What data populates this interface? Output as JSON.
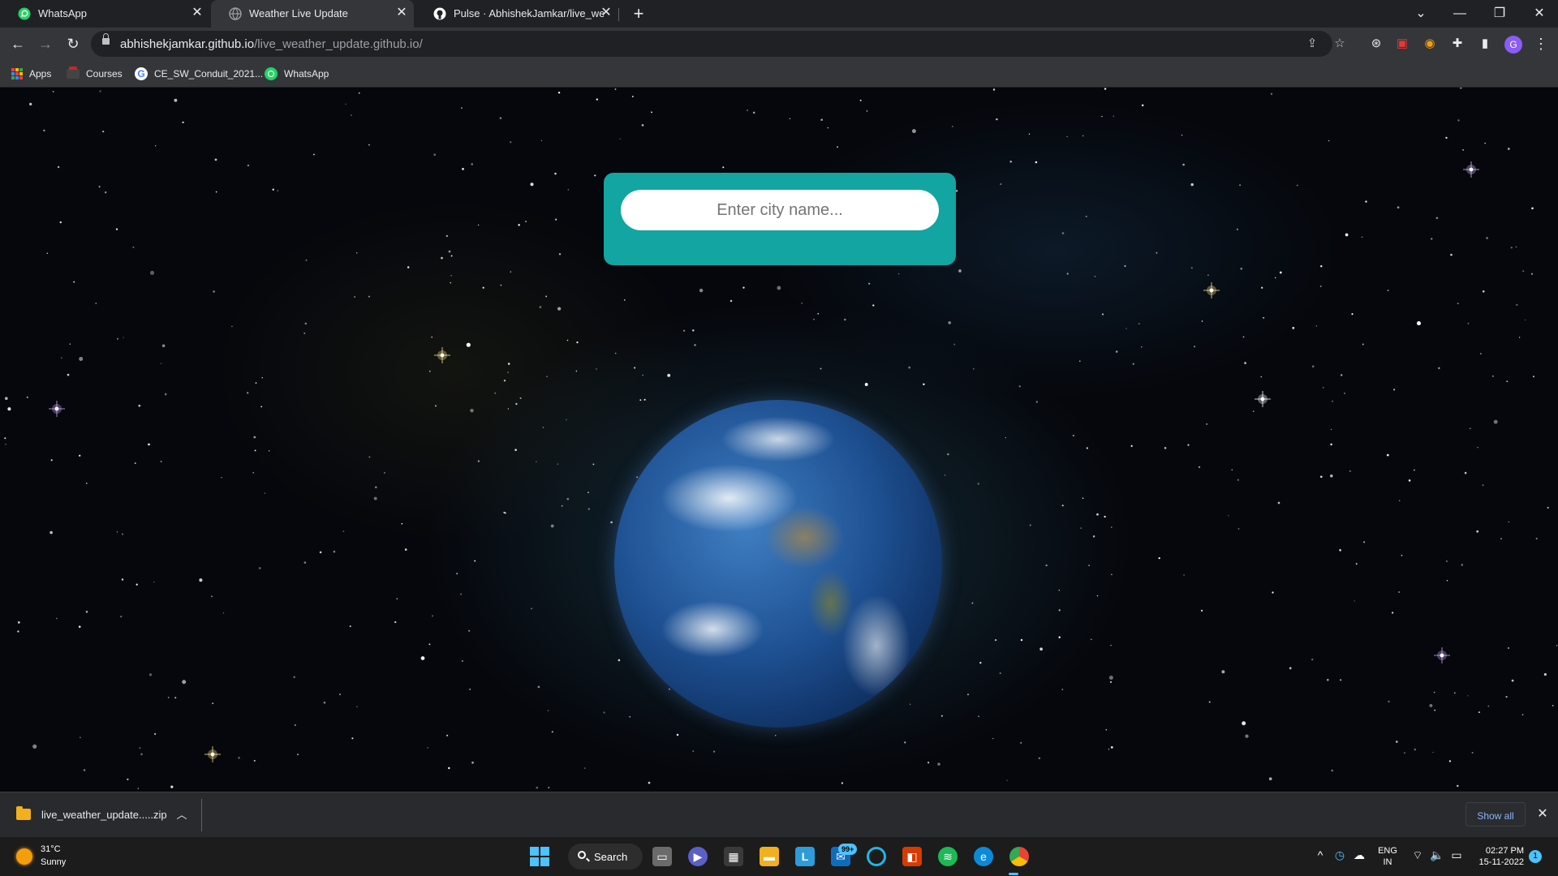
{
  "tabs": [
    {
      "title": "WhatsApp",
      "icon": "whatsapp-icon",
      "active": false
    },
    {
      "title": "Weather Live Update",
      "icon": "globe-icon",
      "active": true
    },
    {
      "title": "Pulse · AbhishekJamkar/live_weathe",
      "icon": "github-icon",
      "active": false
    }
  ],
  "address": {
    "host": "abhishekjamkar.github.io",
    "path": "/live_weather_update.github.io/"
  },
  "bookmarks": [
    {
      "label": "Apps",
      "icon": "apps-grid-icon"
    },
    {
      "label": "Courses",
      "icon": "courses-icon"
    },
    {
      "label": "CE_SW_Conduit_2021...",
      "icon": "google-icon"
    },
    {
      "label": "WhatsApp",
      "icon": "whatsapp-icon"
    }
  ],
  "search": {
    "placeholder": "Enter city name...",
    "value": ""
  },
  "download": {
    "filename": "live_weather_update.....zip",
    "show_all": "Show all"
  },
  "taskbar": {
    "weather_temp": "31°C",
    "weather_cond": "Sunny",
    "search_label": "Search",
    "mail_badge": "99+",
    "lang_line1": "ENG",
    "lang_line2": "IN",
    "time": "02:27 PM",
    "date": "15-11-2022",
    "notifications": "1"
  },
  "colors": {
    "search_card": "#12a5a2",
    "accent": "#4cc2ff",
    "link": "#8ab4f8"
  }
}
